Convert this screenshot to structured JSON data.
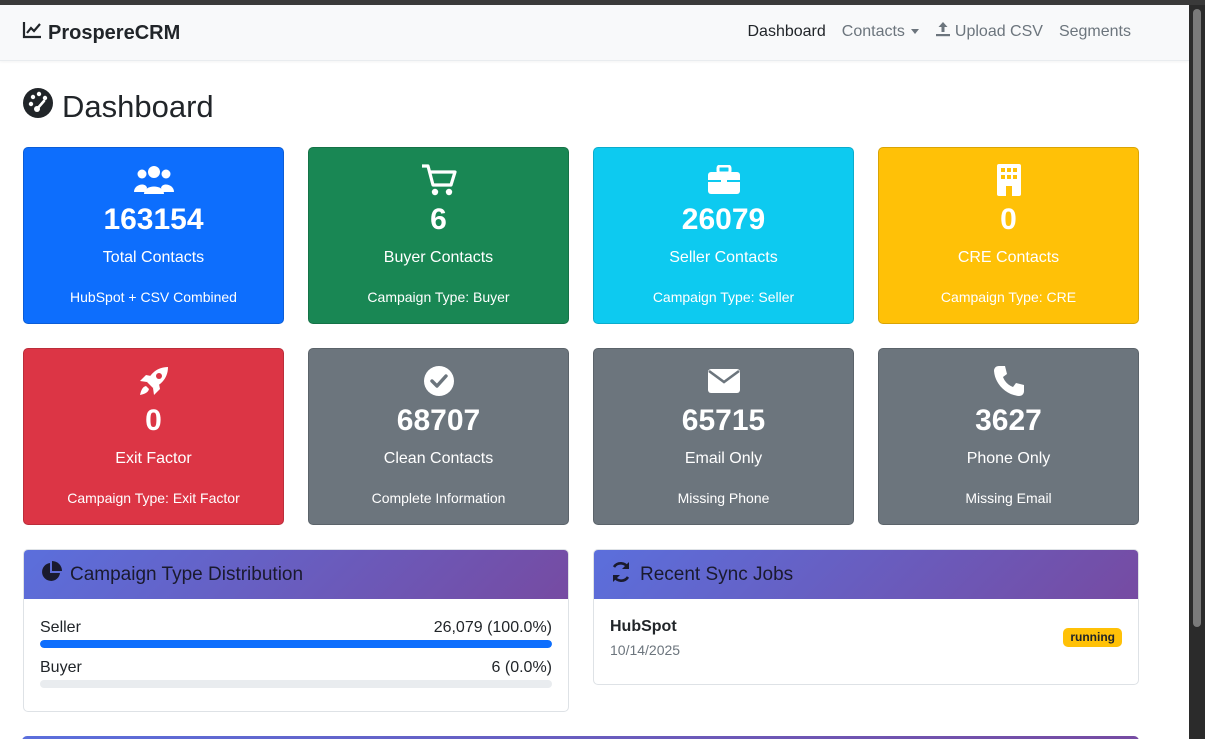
{
  "brand": {
    "name": "ProspereCRM",
    "icon": "chart-line-icon"
  },
  "nav": {
    "dashboard": "Dashboard",
    "contacts": "Contacts",
    "upload_csv": "Upload CSV",
    "segments": "Segments"
  },
  "page": {
    "title": "Dashboard",
    "icon": "gauge-icon"
  },
  "cards": [
    {
      "value": "163154",
      "label": "Total Contacts",
      "sub": "HubSpot + CSV Combined",
      "icon": "users-icon",
      "color": "#0d6efd"
    },
    {
      "value": "6",
      "label": "Buyer Contacts",
      "sub": "Campaign Type: Buyer",
      "icon": "cart-icon",
      "color": "#198754"
    },
    {
      "value": "26079",
      "label": "Seller Contacts",
      "sub": "Campaign Type: Seller",
      "icon": "briefcase-icon",
      "color": "#0dcaf0"
    },
    {
      "value": "0",
      "label": "CRE Contacts",
      "sub": "Campaign Type: CRE",
      "icon": "building-icon",
      "color": "#ffc107"
    },
    {
      "value": "0",
      "label": "Exit Factor",
      "sub": "Campaign Type: Exit Factor",
      "icon": "rocket-icon",
      "color": "#dc3545"
    },
    {
      "value": "68707",
      "label": "Clean Contacts",
      "sub": "Complete Information",
      "icon": "check-circle-icon",
      "color": "#6c757d"
    },
    {
      "value": "65715",
      "label": "Email Only",
      "sub": "Missing Phone",
      "icon": "envelope-icon",
      "color": "#6c757d"
    },
    {
      "value": "3627",
      "label": "Phone Only",
      "sub": "Missing Email",
      "icon": "phone-icon",
      "color": "#6c757d"
    }
  ],
  "distribution": {
    "title": "Campaign Type Distribution",
    "rows": [
      {
        "name": "Seller",
        "count": "26,079 (100.0%)",
        "fraction": 1.0
      },
      {
        "name": "Buyer",
        "count": "6 (0.0%)",
        "fraction": 0.0
      }
    ]
  },
  "sync": {
    "title": "Recent Sync Jobs",
    "jobs": [
      {
        "name": "HubSpot",
        "date": "10/14/2025",
        "status": "running"
      }
    ]
  }
}
